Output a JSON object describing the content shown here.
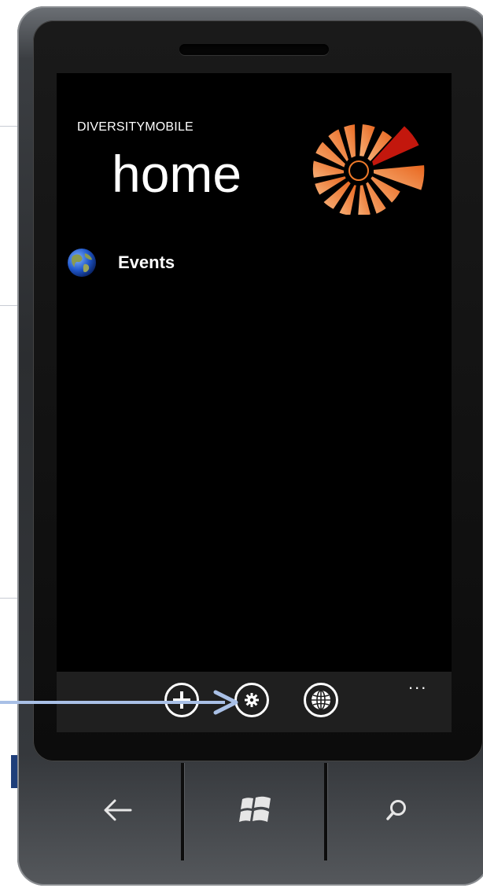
{
  "app": {
    "app_title": "DIVERSITYMOBILE",
    "page_title": "home"
  },
  "list": {
    "items": [
      {
        "label": "Events",
        "icon": "globe-icon"
      }
    ]
  },
  "appbar": {
    "buttons": [
      {
        "icon": "add-icon"
      },
      {
        "icon": "settings-icon"
      },
      {
        "icon": "globe-grid-icon"
      }
    ],
    "more_label": "..."
  },
  "hardware_keys": [
    {
      "icon": "back-arrow-icon"
    },
    {
      "icon": "windows-logo-icon"
    },
    {
      "icon": "search-icon"
    }
  ],
  "colors": {
    "screen_background": "#000000",
    "appbar_background": "#1f1f1f",
    "annotation_arrow": "#a9c0e6",
    "logo_orange": "#f07a2a",
    "logo_red": "#c3170d"
  }
}
